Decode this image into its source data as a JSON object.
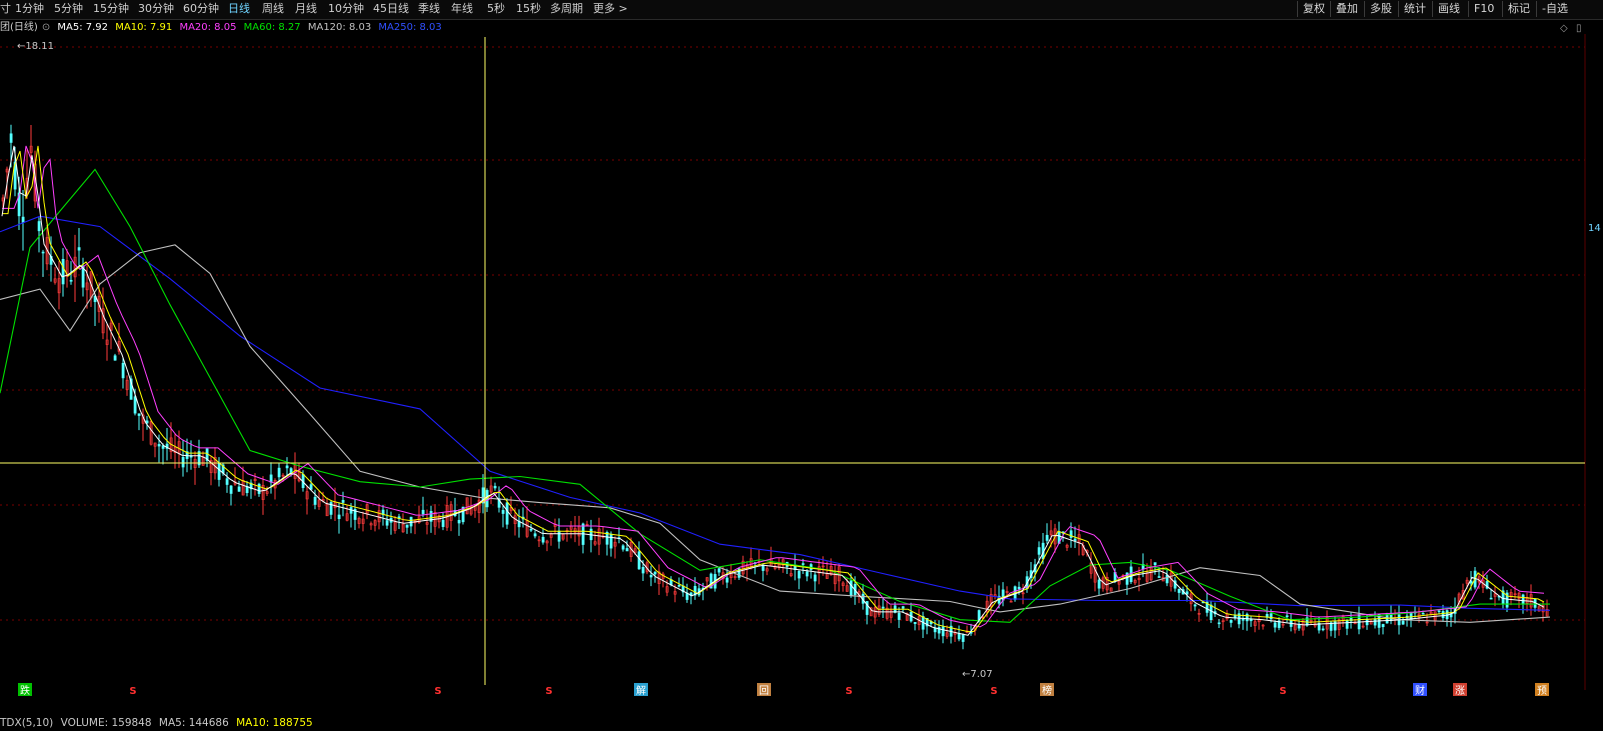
{
  "toolbar": {
    "periods": [
      {
        "label": "1分钟",
        "active": false
      },
      {
        "label": "5分钟",
        "active": false
      },
      {
        "label": "15分钟",
        "active": false
      },
      {
        "label": "30分钟",
        "active": false
      },
      {
        "label": "60分钟",
        "active": false
      },
      {
        "label": "日线",
        "active": true
      },
      {
        "label": "周线",
        "active": false
      },
      {
        "label": "月线",
        "active": false
      },
      {
        "label": "10分钟",
        "active": false
      },
      {
        "label": "45日线",
        "active": false
      },
      {
        "label": "季线",
        "active": false
      },
      {
        "label": "年线",
        "active": false
      },
      {
        "label": "5秒",
        "active": false
      },
      {
        "label": "15秒",
        "active": false
      },
      {
        "label": "多周期",
        "active": false
      }
    ],
    "more": "更多 >",
    "right_buttons": [
      "复权",
      "叠加",
      "多股",
      "统计",
      "画线",
      "F10",
      "标记",
      "-自选"
    ]
  },
  "legend": {
    "title": "团(日线)",
    "ma5": "MA5: 7.92",
    "ma10": "MA10: 7.91",
    "ma20": "MA20: 8.05",
    "ma60": "MA60: 8.27",
    "ma120": "MA120: 8.03",
    "ma250": "MA250: 8.03"
  },
  "volume_bar": {
    "indicator": "TDX(5,10)",
    "volume": "VOLUME: 159848",
    "ma5": "MA5: 144686",
    "ma10": "MA10: 188755"
  },
  "colors": {
    "up": "#ff3c3c",
    "down": "#54ffff",
    "ma5": "#ffffff",
    "ma10": "#ffff00",
    "ma20": "#ff40ff",
    "ma60": "#00e000",
    "ma120": "#c0c0c0",
    "ma250": "#2020ff",
    "grid": "#7a0000",
    "crosshair": "#ffff66"
  },
  "chart_data": {
    "type": "candlestick",
    "title": "团(日线)",
    "price_high_label": "18.11",
    "price_low_label": "7.07",
    "right_axis_partial_label": "14",
    "ylim": [
      6.4,
      19.0
    ],
    "series": [
      {
        "name": "MA250",
        "points": [
          [
            0,
            15.2
          ],
          [
            40,
            15.5
          ],
          [
            100,
            15.3
          ],
          [
            170,
            14.3
          ],
          [
            240,
            13.2
          ],
          [
            320,
            12.2
          ],
          [
            420,
            11.8
          ],
          [
            490,
            10.6
          ],
          [
            570,
            10.1
          ],
          [
            640,
            9.8
          ],
          [
            720,
            9.2
          ],
          [
            800,
            9.0
          ],
          [
            880,
            8.65
          ],
          [
            960,
            8.3
          ],
          [
            1010,
            8.15
          ],
          [
            1100,
            8.12
          ],
          [
            1200,
            8.12
          ],
          [
            1300,
            8.02
          ],
          [
            1400,
            8.03
          ],
          [
            1470,
            7.97
          ],
          [
            1550,
            7.93
          ]
        ]
      },
      {
        "name": "MA120",
        "points": [
          [
            0,
            13.9
          ],
          [
            40,
            14.1
          ],
          [
            70,
            13.3
          ],
          [
            100,
            14.2
          ],
          [
            140,
            14.8
          ],
          [
            175,
            14.95
          ],
          [
            210,
            14.4
          ],
          [
            250,
            13.0
          ],
          [
            310,
            11.7
          ],
          [
            360,
            10.6
          ],
          [
            420,
            10.3
          ],
          [
            480,
            10.1
          ],
          [
            540,
            10.0
          ],
          [
            610,
            9.9
          ],
          [
            660,
            9.6
          ],
          [
            700,
            8.9
          ],
          [
            780,
            8.3
          ],
          [
            860,
            8.2
          ],
          [
            950,
            8.1
          ],
          [
            1000,
            7.9
          ],
          [
            1060,
            8.05
          ],
          [
            1130,
            8.35
          ],
          [
            1200,
            8.75
          ],
          [
            1260,
            8.6
          ],
          [
            1300,
            8.05
          ],
          [
            1400,
            7.75
          ],
          [
            1470,
            7.7
          ],
          [
            1550,
            7.8
          ]
        ]
      },
      {
        "name": "MA60",
        "points": [
          [
            0,
            12.1
          ],
          [
            30,
            14.9
          ],
          [
            60,
            15.6
          ],
          [
            95,
            16.4
          ],
          [
            130,
            15.3
          ],
          [
            170,
            13.8
          ],
          [
            210,
            12.4
          ],
          [
            250,
            11.0
          ],
          [
            300,
            10.7
          ],
          [
            360,
            10.4
          ],
          [
            420,
            10.3
          ],
          [
            470,
            10.45
          ],
          [
            520,
            10.5
          ],
          [
            580,
            10.35
          ],
          [
            640,
            9.4
          ],
          [
            700,
            8.7
          ],
          [
            760,
            8.9
          ],
          [
            830,
            8.7
          ],
          [
            900,
            8.1
          ],
          [
            960,
            7.75
          ],
          [
            1010,
            7.7
          ],
          [
            1050,
            8.4
          ],
          [
            1090,
            8.8
          ],
          [
            1130,
            8.85
          ],
          [
            1170,
            8.7
          ],
          [
            1230,
            8.2
          ],
          [
            1290,
            7.75
          ],
          [
            1360,
            7.8
          ],
          [
            1420,
            7.9
          ],
          [
            1480,
            8.05
          ],
          [
            1530,
            8.05
          ],
          [
            1550,
            8.05
          ]
        ]
      }
    ],
    "volume_indicator": {
      "name": "TDX(5,10)",
      "volume": 159848,
      "ma5": 144686,
      "ma10": 188755
    },
    "event_markers": [
      {
        "label": "跌",
        "color": "#00c000"
      },
      {
        "label": "S",
        "color": "#ff3030"
      },
      {
        "label": "S",
        "color": "#ff3030"
      },
      {
        "label": "S",
        "color": "#ff3030"
      },
      {
        "label": "解",
        "color": "#2aa0d0"
      },
      {
        "label": "回",
        "color": "#c08040"
      },
      {
        "label": "S",
        "color": "#ff3030"
      },
      {
        "label": "S",
        "color": "#ff3030"
      },
      {
        "label": "榜",
        "color": "#c08040"
      },
      {
        "label": "S",
        "color": "#ff3030"
      },
      {
        "label": "财",
        "color": "#3050ff"
      },
      {
        "label": "涨",
        "color": "#d04030"
      },
      {
        "label": "预",
        "color": "#d08020"
      }
    ],
    "grid": true
  }
}
